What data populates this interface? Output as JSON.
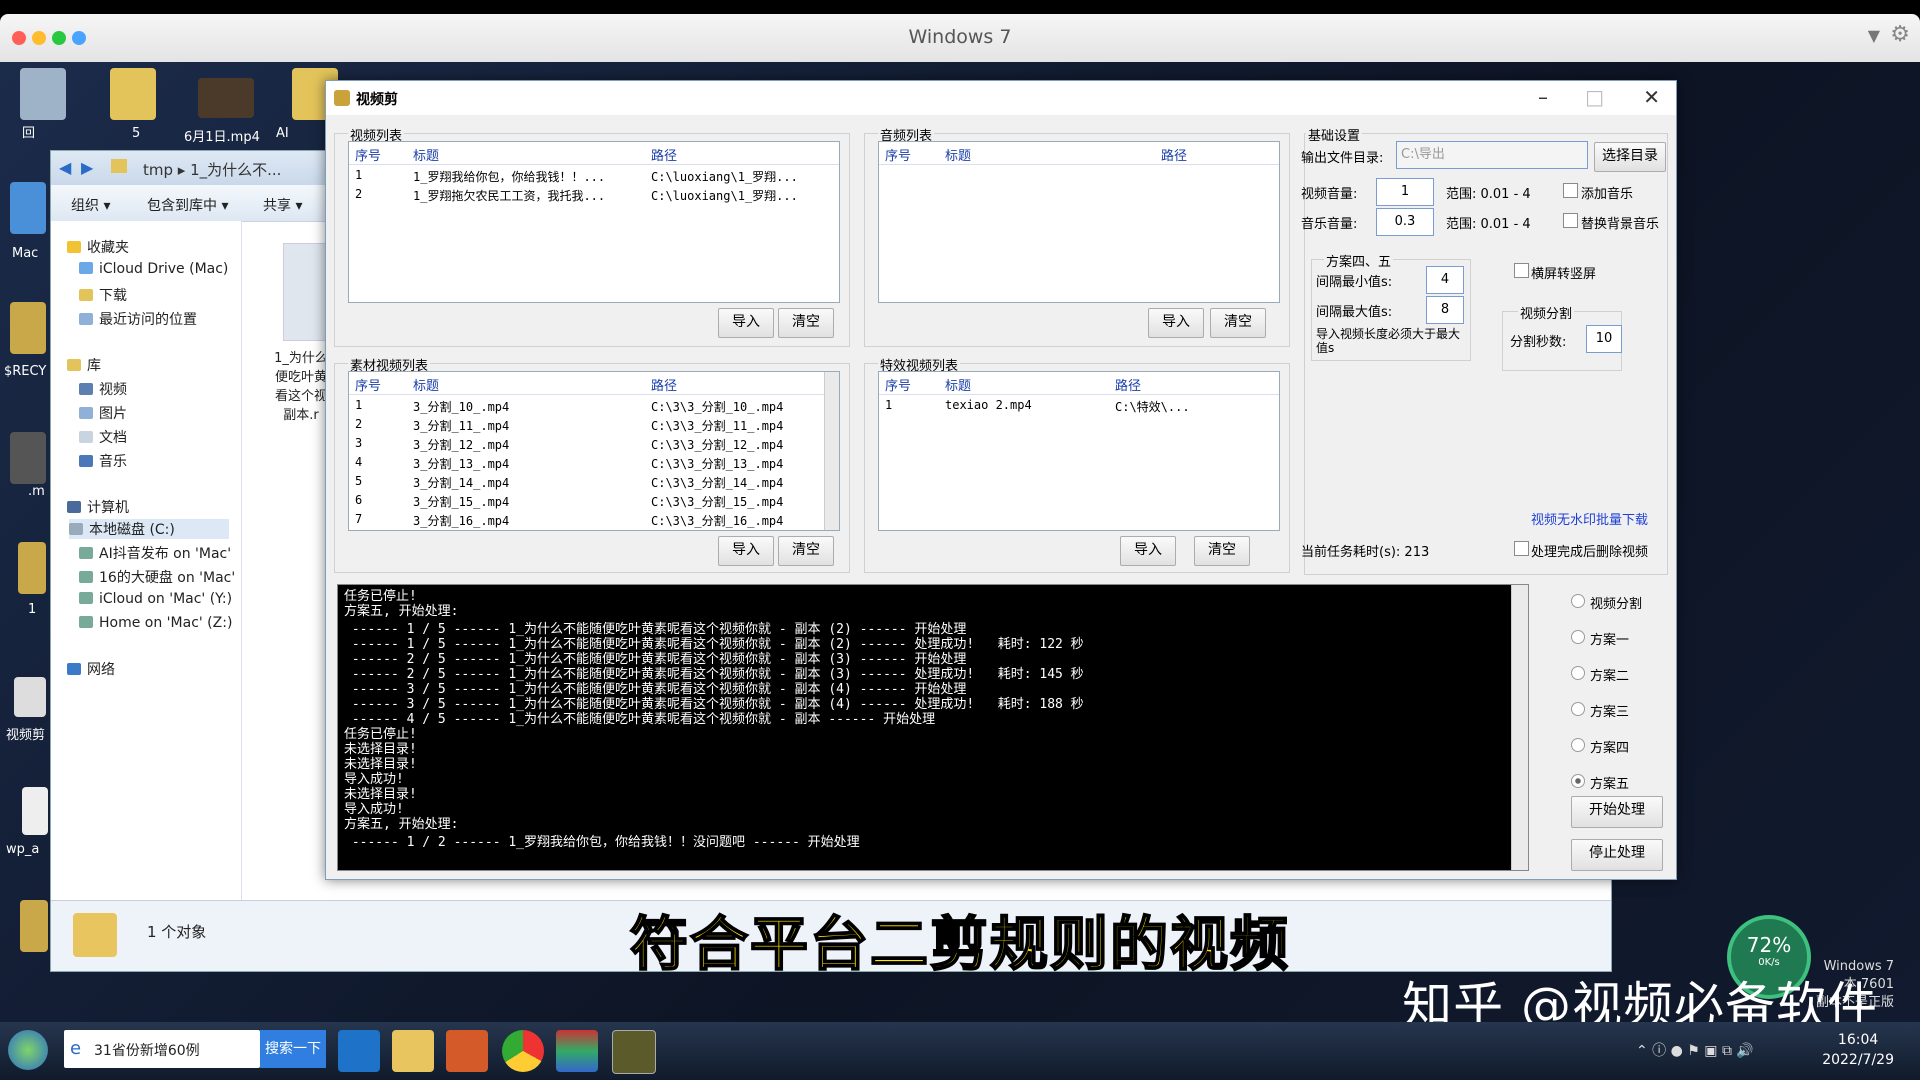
{
  "host": {
    "title": "Windows 7"
  },
  "desktop": {
    "labels": [
      "回",
      "Mac",
      "$RECY",
      ".m",
      "1",
      "视频剪",
      "wp_a"
    ],
    "file_labels": [
      "5",
      "6月1日.mp4",
      "AI"
    ]
  },
  "explorer": {
    "path": "tmp ▸ 1_为什么不...",
    "toolbar": [
      "组织 ▾",
      "包含到库中 ▾",
      "共享 ▾"
    ],
    "nav": [
      "收藏夹",
      "iCloud Drive (Mac)",
      "下载",
      "最近访问的位置",
      "库",
      "视频",
      "图片",
      "文档",
      "音乐",
      "计算机",
      "本地磁盘 (C:)",
      "AI抖音发布 on 'Mac'",
      "16的大硬盘 on 'Mac'",
      "iCloud on 'Mac' (Y:)",
      "Home on 'Mac' (Z:)",
      "网络"
    ],
    "file_name": [
      "1_为什么",
      "便吃叶黄",
      "看这个视",
      "副本.r"
    ],
    "status": "1 个对象"
  },
  "app": {
    "title": "视频剪",
    "video_list": {
      "title": "视频列表",
      "headers": [
        "序号",
        "标题",
        "路径"
      ],
      "rows": [
        [
          "1",
          "1_罗翔我给你包，你给我钱！！...",
          "C:\\luoxiang\\1_罗翔..."
        ],
        [
          "2",
          "1_罗翔拖欠农民工工资，我托我...",
          "C:\\luoxiang\\1_罗翔..."
        ]
      ],
      "import": "导入",
      "clear": "清空"
    },
    "audio_list": {
      "title": "音频列表",
      "headers": [
        "序号",
        "标题",
        "路径"
      ],
      "import": "导入",
      "clear": "清空"
    },
    "material_list": {
      "title": "素材视频列表",
      "headers": [
        "序号",
        "标题",
        "路径"
      ],
      "rows": [
        [
          "1",
          "3_分割_10_.mp4",
          "C:\\3\\3_分割_10_.mp4"
        ],
        [
          "2",
          "3_分割_11_.mp4",
          "C:\\3\\3_分割_11_.mp4"
        ],
        [
          "3",
          "3_分割_12_.mp4",
          "C:\\3\\3_分割_12_.mp4"
        ],
        [
          "4",
          "3_分割_13_.mp4",
          "C:\\3\\3_分割_13_.mp4"
        ],
        [
          "5",
          "3_分割_14_.mp4",
          "C:\\3\\3_分割_14_.mp4"
        ],
        [
          "6",
          "3_分割_15_.mp4",
          "C:\\3\\3_分割_15_.mp4"
        ],
        [
          "7",
          "3_分割_16_.mp4",
          "C:\\3\\3_分割_16_.mp4"
        ]
      ],
      "import": "导入",
      "clear": "清空"
    },
    "effect_list": {
      "title": "特效视频列表",
      "headers": [
        "序号",
        "标题",
        "路径"
      ],
      "rows": [
        [
          "1",
          "texiao 2.mp4",
          "C:\\特效\\..."
        ]
      ],
      "import": "导入",
      "clear": "清空"
    },
    "settings": {
      "title": "基础设置",
      "output_label": "输出文件目录:",
      "output_value": "C:\\导出",
      "choose_dir": "选择目录",
      "video_vol_label": "视频音量:",
      "video_vol": "1",
      "video_range": "范围: 0.01 - 4",
      "add_music": "添加音乐",
      "music_vol_label": "音乐音量:",
      "music_vol": "0.3",
      "music_range": "范围: 0.01 - 4",
      "replace_bg": "替换背景音乐",
      "scheme45": "方案四、五",
      "min_interval_label": "间隔最小值s:",
      "min_interval": "4",
      "max_interval_label": "间隔最大值s:",
      "max_interval": "8",
      "import_note": "导入视频长度必须大于最大值s",
      "landscape": "横屏转竖屏",
      "split_title": "视频分割",
      "split_seconds_label": "分割秒数:",
      "split_seconds": "10",
      "watermark_link": "视频无水印批量下载",
      "task_time": "当前任务耗时(s): 213",
      "delete_after": "处理完成后删除视频"
    },
    "console": [
      "任务已停止!",
      "方案五, 开始处理:",
      " ------ 1 / 5 ------ 1_为什么不能随便吃叶黄素呢看这个视频你就 - 副本 (2) ------ 开始处理",
      " ------ 1 / 5 ------ 1_为什么不能随便吃叶黄素呢看这个视频你就 - 副本 (2) ------ 处理成功!   耗时: 122 秒",
      " ------ 2 / 5 ------ 1_为什么不能随便吃叶黄素呢看这个视频你就 - 副本 (3) ------ 开始处理",
      " ------ 2 / 5 ------ 1_为什么不能随便吃叶黄素呢看这个视频你就 - 副本 (3) ------ 处理成功!   耗时: 145 秒",
      " ------ 3 / 5 ------ 1_为什么不能随便吃叶黄素呢看这个视频你就 - 副本 (4) ------ 开始处理",
      " ------ 3 / 5 ------ 1_为什么不能随便吃叶黄素呢看这个视频你就 - 副本 (4) ------ 处理成功!   耗时: 188 秒",
      " ------ 4 / 5 ------ 1_为什么不能随便吃叶黄素呢看这个视频你就 - 副本 ------ 开始处理",
      "任务已停止!",
      "未选择目录!",
      "未选择目录!",
      "导入成功!",
      "未选择目录!",
      "导入成功!",
      "方案五, 开始处理:",
      " ------ 1 / 2 ------ 1_罗翔我给你包，你给我钱！！没问题吧 ------ 开始处理"
    ],
    "modes": [
      "视频分割",
      "方案一",
      "方案二",
      "方案三",
      "方案四",
      "方案五"
    ],
    "selected_mode": "方案五",
    "start": "开始处理",
    "stop": "停止处理"
  },
  "taskbar": {
    "browser_tab": "31省份新增60例",
    "search_btn": "搜索一下",
    "time": "16:04",
    "date": "2022/7/29",
    "os_note": [
      "Windows 7",
      "本 7601",
      "副本不是正版"
    ]
  },
  "overlay": {
    "subtitle": "符合平台二剪规则的视频",
    "watermark": "知乎 @视频必备软件",
    "gauge_value": "72%",
    "gauge_rate": "0K/s"
  },
  "colors": {
    "accent": "#1f3fd4",
    "subtitle": "#ffe600",
    "header_text": "#1a3fa8"
  }
}
